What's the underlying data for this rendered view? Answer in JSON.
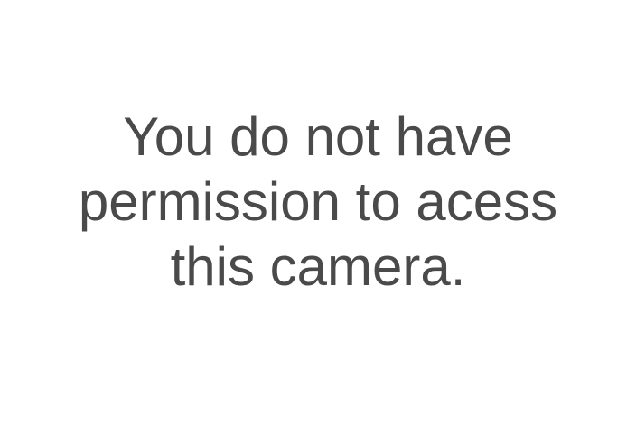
{
  "message": {
    "lines": [
      "You do not have",
      "permission to acess",
      "this camera."
    ]
  }
}
